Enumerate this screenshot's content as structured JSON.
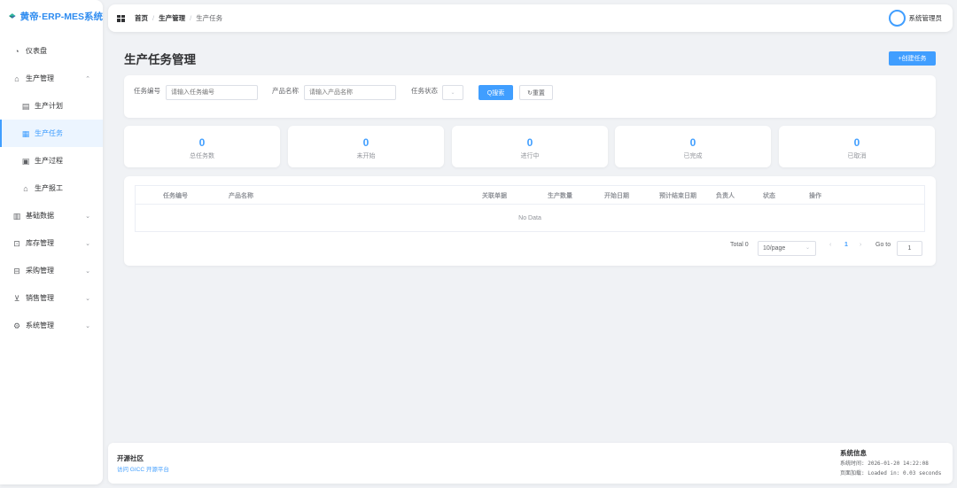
{
  "sidebar": {
    "logo_text": "黄帝·ERP-MES系统",
    "items": [
      {
        "label": "仪表盘",
        "icon": "dashboard-icon"
      },
      {
        "label": "生产管理",
        "icon": "factory-icon"
      },
      {
        "label": "生产计划",
        "icon": "calendar-icon"
      },
      {
        "label": "生产任务",
        "icon": "task-icon"
      },
      {
        "label": "生产过程",
        "icon": "process-icon"
      },
      {
        "label": "生产报工",
        "icon": "report-icon"
      },
      {
        "label": "基础数据",
        "icon": "database-icon"
      },
      {
        "label": "库存管理",
        "icon": "warehouse-icon"
      },
      {
        "label": "采购管理",
        "icon": "purchase-icon"
      },
      {
        "label": "销售管理",
        "icon": "cart-icon"
      },
      {
        "label": "系统管理",
        "icon": "gear-icon"
      }
    ]
  },
  "header": {
    "breadcrumb": [
      "首页",
      "生产管理",
      "生产任务"
    ],
    "user_name": "系统管理员"
  },
  "page": {
    "title": "生产任务管理",
    "create_label": "+创建任务"
  },
  "search": {
    "task_no_label": "任务编号",
    "task_no_placeholder": "请输入任务编号",
    "product_label": "产品名称",
    "product_placeholder": "请输入产品名称",
    "status_label": "任务状态",
    "search_label": "Q搜索",
    "reset_label": "↻重置"
  },
  "stats": [
    {
      "value": "0",
      "label": "总任务数"
    },
    {
      "value": "0",
      "label": "未开始"
    },
    {
      "value": "0",
      "label": "进行中"
    },
    {
      "value": "0",
      "label": "已完成"
    },
    {
      "value": "0",
      "label": "已取消"
    }
  ],
  "table": {
    "columns": [
      "任务编号",
      "产品名称",
      "关联单据",
      "生产数量",
      "开始日期",
      "预计结束日期",
      "负责人",
      "状态",
      "操作"
    ],
    "empty_text": "No Data"
  },
  "pagination": {
    "total": "Total 0",
    "page_size": "10/page",
    "current_page": "1",
    "goto_label": "Go to",
    "goto_value": "1"
  },
  "footer": {
    "community_title": "开源社区",
    "community_link": "访问 GICC 开源平台",
    "sys_title": "系统信息",
    "sys_time": "系统时间:  2026-01-20 14:22:08",
    "page_load": "页面加载:  Loaded in: 0.03 seconds"
  }
}
